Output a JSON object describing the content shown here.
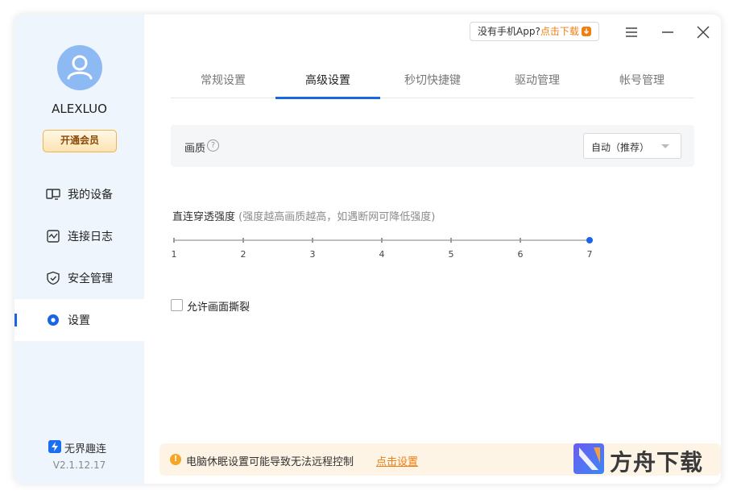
{
  "sidebar": {
    "username": "ALEXLUO",
    "vip_button": "开通会员",
    "items": [
      {
        "label": "我的设备",
        "icon": "monitor-icon"
      },
      {
        "label": "连接日志",
        "icon": "log-icon"
      },
      {
        "label": "安全管理",
        "icon": "shield-icon"
      },
      {
        "label": "设置",
        "icon": "settings-dot-icon",
        "active": true
      }
    ],
    "brand": "无界趣连",
    "version": "V2.1.12.17"
  },
  "topbar": {
    "promo_text": "没有手机App?",
    "promo_link": "点击下载",
    "menu_icon": "menu-icon",
    "minimize_icon": "minimize-icon",
    "close_icon": "close-icon"
  },
  "tabs": [
    "常规设置",
    "高级设置",
    "秒切快捷键",
    "驱动管理",
    "帐号管理"
  ],
  "active_tab": "高级设置",
  "quality": {
    "label": "画质",
    "help": "?",
    "selected": "自动（推荐）"
  },
  "strength": {
    "title": "直连穿透强度",
    "hint": "(强度越高画质越高，如遇断网可降低强度)",
    "min": 1,
    "max": 7,
    "value": 7,
    "ticks": [
      "1",
      "2",
      "3",
      "4",
      "5",
      "6",
      "7"
    ]
  },
  "tear_checkbox": {
    "label": "允许画面撕裂",
    "checked": false
  },
  "warning": {
    "text": "电脑休眠设置可能导致无法远程控制",
    "link": "点击设置"
  },
  "watermark": "方舟下载",
  "colors": {
    "accent": "#1a64e6",
    "sidebar_bg": "#eef5fc",
    "warning_orange": "#f07f13",
    "vip_gold": "#f0b14e"
  }
}
